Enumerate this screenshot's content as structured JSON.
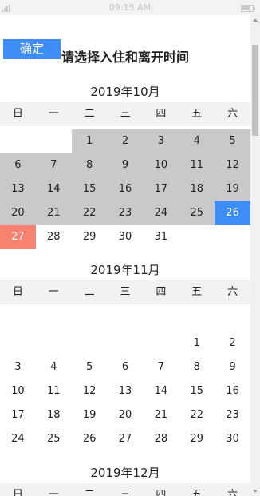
{
  "status_bar": {
    "time": "09:15 AM"
  },
  "header": {
    "confirm_label": "确定",
    "title": "请选择入住和离开时间"
  },
  "weekdays": [
    "日",
    "一",
    "二",
    "三",
    "四",
    "五",
    "六"
  ],
  "months": [
    {
      "title": "2019年10月",
      "cells": [
        {
          "d": "",
          "s": "blank"
        },
        {
          "d": "",
          "s": "blank"
        },
        {
          "d": "1",
          "s": "past"
        },
        {
          "d": "2",
          "s": "past"
        },
        {
          "d": "3",
          "s": "past"
        },
        {
          "d": "4",
          "s": "past"
        },
        {
          "d": "5",
          "s": "past"
        },
        {
          "d": "6",
          "s": "past"
        },
        {
          "d": "7",
          "s": "past"
        },
        {
          "d": "8",
          "s": "past"
        },
        {
          "d": "9",
          "s": "past"
        },
        {
          "d": "10",
          "s": "past"
        },
        {
          "d": "11",
          "s": "past"
        },
        {
          "d": "12",
          "s": "past"
        },
        {
          "d": "13",
          "s": "past"
        },
        {
          "d": "14",
          "s": "past"
        },
        {
          "d": "15",
          "s": "past"
        },
        {
          "d": "16",
          "s": "past"
        },
        {
          "d": "17",
          "s": "past"
        },
        {
          "d": "18",
          "s": "past"
        },
        {
          "d": "19",
          "s": "past"
        },
        {
          "d": "20",
          "s": "past"
        },
        {
          "d": "21",
          "s": "past"
        },
        {
          "d": "22",
          "s": "past"
        },
        {
          "d": "23",
          "s": "past"
        },
        {
          "d": "24",
          "s": "past"
        },
        {
          "d": "25",
          "s": "past"
        },
        {
          "d": "26",
          "s": "start"
        },
        {
          "d": "27",
          "s": "pick"
        },
        {
          "d": "28",
          "s": "normal"
        },
        {
          "d": "29",
          "s": "normal"
        },
        {
          "d": "30",
          "s": "normal"
        },
        {
          "d": "31",
          "s": "normal"
        }
      ]
    },
    {
      "title": "2019年11月",
      "cells": [
        {
          "d": "",
          "s": "blank"
        },
        {
          "d": "",
          "s": "blank"
        },
        {
          "d": "",
          "s": "blank"
        },
        {
          "d": "",
          "s": "blank"
        },
        {
          "d": "",
          "s": "blank"
        },
        {
          "d": "",
          "s": "blank"
        },
        {
          "d": "",
          "s": "blank"
        },
        {
          "d": "",
          "s": "blank"
        },
        {
          "d": "",
          "s": "blank"
        },
        {
          "d": "",
          "s": "blank"
        },
        {
          "d": "",
          "s": "blank"
        },
        {
          "d": "",
          "s": "blank"
        },
        {
          "d": "1",
          "s": "normal"
        },
        {
          "d": "2",
          "s": "normal"
        },
        {
          "d": "3",
          "s": "normal"
        },
        {
          "d": "4",
          "s": "normal"
        },
        {
          "d": "5",
          "s": "normal"
        },
        {
          "d": "6",
          "s": "normal"
        },
        {
          "d": "7",
          "s": "normal"
        },
        {
          "d": "8",
          "s": "normal"
        },
        {
          "d": "9",
          "s": "normal"
        },
        {
          "d": "10",
          "s": "normal"
        },
        {
          "d": "11",
          "s": "normal"
        },
        {
          "d": "12",
          "s": "normal"
        },
        {
          "d": "13",
          "s": "normal"
        },
        {
          "d": "14",
          "s": "normal"
        },
        {
          "d": "15",
          "s": "normal"
        },
        {
          "d": "16",
          "s": "normal"
        },
        {
          "d": "17",
          "s": "normal"
        },
        {
          "d": "18",
          "s": "normal"
        },
        {
          "d": "19",
          "s": "normal"
        },
        {
          "d": "20",
          "s": "normal"
        },
        {
          "d": "21",
          "s": "normal"
        },
        {
          "d": "22",
          "s": "normal"
        },
        {
          "d": "23",
          "s": "normal"
        },
        {
          "d": "24",
          "s": "normal"
        },
        {
          "d": "25",
          "s": "normal"
        },
        {
          "d": "26",
          "s": "normal"
        },
        {
          "d": "27",
          "s": "normal"
        },
        {
          "d": "28",
          "s": "normal"
        },
        {
          "d": "29",
          "s": "normal"
        },
        {
          "d": "30",
          "s": "normal"
        }
      ]
    },
    {
      "title": "2019年12月",
      "cells": []
    }
  ],
  "colors": {
    "accent": "#3d8df5",
    "selected": "#f7826f",
    "past": "#c9c9c9",
    "weekbar": "#f2f2f2"
  }
}
